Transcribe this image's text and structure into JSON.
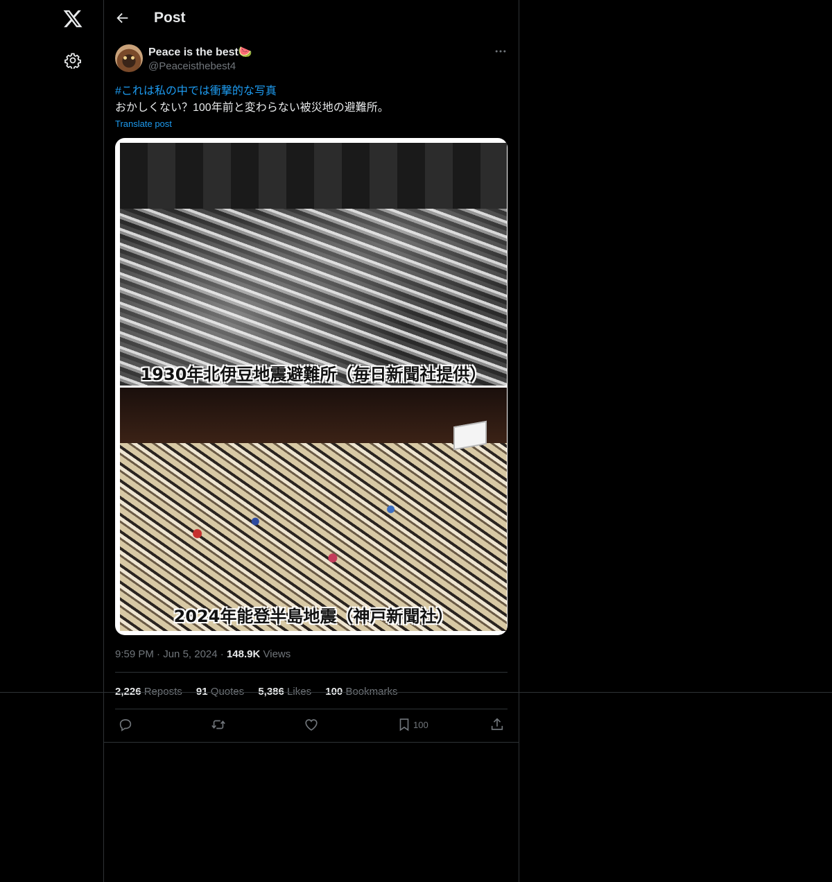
{
  "header": {
    "title": "Post"
  },
  "post": {
    "display_name": "Peace is the best🍉",
    "handle": "@Peaceisthebest4",
    "hashtag": "#これは私の中では衝撃的な写真",
    "text": "おかしくない？100年前と変わらない被災地の避難所。",
    "translate_label": "Translate post",
    "media": {
      "caption_top": "1930年北伊豆地震避難所（毎日新聞社提供）",
      "caption_bottom": "2024年能登半島地震（神戸新聞社）"
    },
    "time": "9:59 PM",
    "date": "Jun 5, 2024",
    "views_count": "148.9K",
    "views_label": "Views",
    "stats": {
      "reposts_count": "2,226",
      "reposts_label": "Reposts",
      "quotes_count": "91",
      "quotes_label": "Quotes",
      "likes_count": "5,386",
      "likes_label": "Likes",
      "bookmarks_count": "100",
      "bookmarks_label": "Bookmarks"
    },
    "actions": {
      "bookmark_count": "100"
    }
  },
  "icons": {
    "logo": "x-logo-icon",
    "settings": "gear-icon",
    "back": "arrow-left-icon",
    "more": "more-horizontal-icon",
    "reply": "reply-icon",
    "repost": "repost-icon",
    "like": "heart-icon",
    "bookmark": "bookmark-icon",
    "share": "share-icon"
  },
  "colors": {
    "background": "#000000",
    "accent": "#1d9bf0",
    "text": "#e7e9ea",
    "muted": "#71767b",
    "border": "#2f3336"
  }
}
